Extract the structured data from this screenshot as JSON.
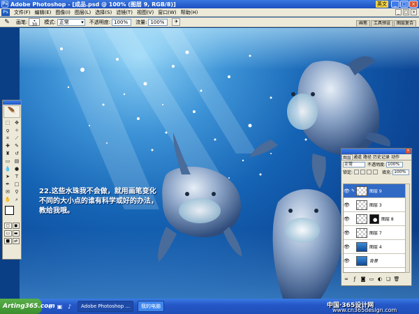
{
  "window": {
    "title": "Adobe Photoshop - [成品.psd @ 100% (图层 9, RGB/8)]",
    "lang_indicator": "英文",
    "minimize": "_",
    "maximize": "□",
    "close": "×"
  },
  "menu": {
    "items": [
      "文件(F)",
      "编辑(E)",
      "图像(I)",
      "图层(L)",
      "选择(S)",
      "滤镜(T)",
      "视图(V)",
      "窗口(W)",
      "帮助(H)"
    ]
  },
  "options_bar": {
    "brush_label": "画笔:",
    "brush_size": "30",
    "mode_label": "模式:",
    "mode_value": "正常",
    "opacity_label": "不透明度:",
    "opacity_value": "100%",
    "flow_label": "流量:",
    "flow_value": "100%",
    "palette_tabs": [
      "画笔",
      "工具预设",
      "图层复合"
    ]
  },
  "canvas": {
    "caption": "22.这些水珠我不会做，就用画笔变化不同的大小点的谁有科学或好的办法，教给我哦。"
  },
  "layers_panel": {
    "tabs": [
      "图层",
      "通道",
      "路径",
      "历史记录",
      "动作"
    ],
    "blend_mode": "正常",
    "opacity_label": "不透明度:",
    "opacity_value": "100%",
    "lock_label": "锁定:",
    "fill_label": "填充:",
    "fill_value": "100%",
    "layers": [
      {
        "name": "图层 9",
        "active": true
      },
      {
        "name": "图层 3",
        "active": false
      },
      {
        "name": "图层 8",
        "active": false
      },
      {
        "name": "图层 7",
        "active": false
      },
      {
        "name": "图层 4",
        "active": false
      },
      {
        "name": "背景",
        "active": false
      }
    ]
  },
  "taskbar": {
    "start_label": "Arting365.com",
    "tasks": [
      "Adobe Photoshop ...",
      "我的电脑"
    ]
  },
  "watermark": {
    "line1": "中国·365设计网",
    "line2": "www.cn365design.com"
  }
}
